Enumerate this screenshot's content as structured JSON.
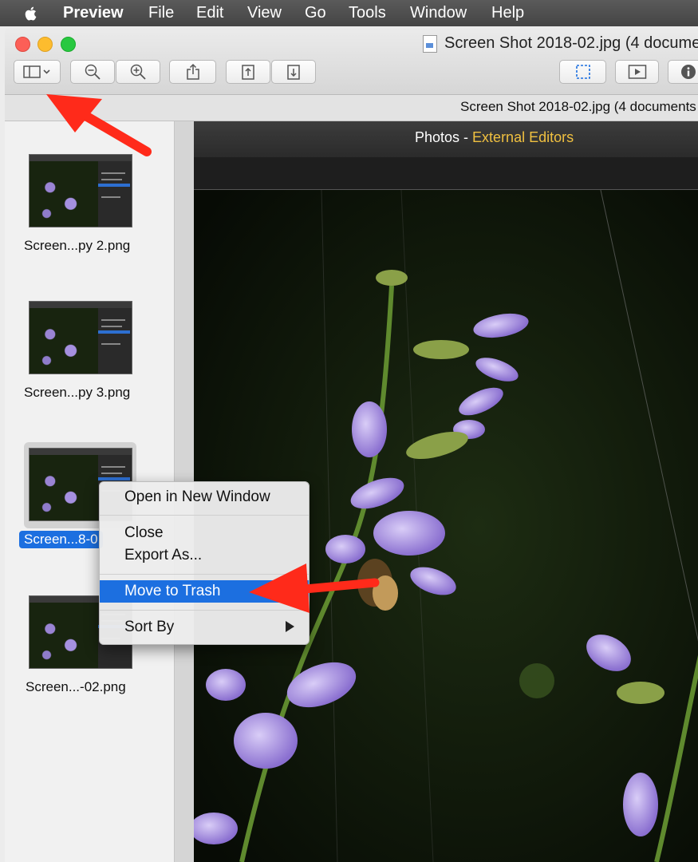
{
  "menubar": {
    "app": "Preview",
    "items": [
      "File",
      "Edit",
      "View",
      "Go",
      "Tools",
      "Window",
      "Help"
    ]
  },
  "window": {
    "title": "Screen Shot 2018-02.jpg (4 docume",
    "subtitle": "Screen Shot 2018-02.jpg (4 documents",
    "toolbar": {
      "icons": [
        "sidebar-icon",
        "zoom-out-icon",
        "zoom-in-icon",
        "share-icon",
        "rotate-left-icon",
        "rotate-right-icon",
        "selection-icon",
        "slideshow-icon",
        "info-icon"
      ]
    }
  },
  "sidebar": {
    "items": [
      {
        "label": "Screen...py 2.png",
        "selected": false
      },
      {
        "label": "Screen...py 3.png",
        "selected": false
      },
      {
        "label": "Screen...8-0",
        "selected": true
      },
      {
        "label": "Screen...-02.png",
        "selected": false
      }
    ]
  },
  "document": {
    "header_title": "Photos",
    "header_sep": " - ",
    "header_accent": "External Editors"
  },
  "context_menu": {
    "items": [
      {
        "label": "Open in New Window"
      },
      {
        "label": "Close"
      },
      {
        "label": "Export As..."
      },
      {
        "label": "Move to Trash",
        "highlighted": true
      },
      {
        "label": "Sort By",
        "submenu": true
      }
    ]
  },
  "colors": {
    "accent_blue": "#1c6fe0",
    "annotation_red": "#ff2a1a",
    "header_accent": "#f0c040"
  }
}
